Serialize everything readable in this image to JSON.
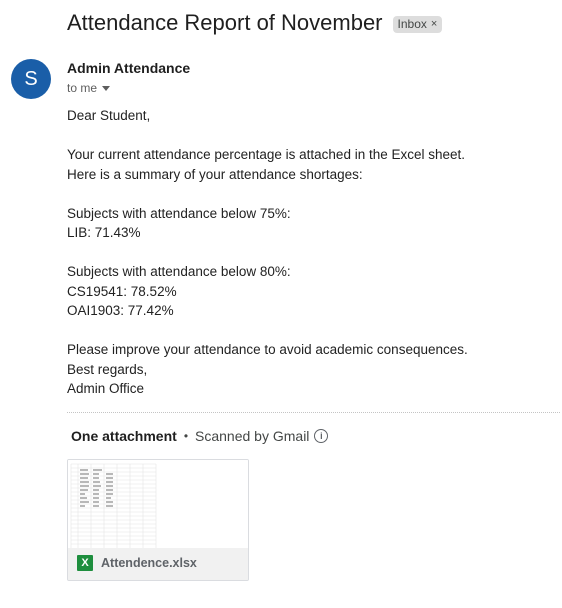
{
  "email": {
    "subject": "Attendance Report of November",
    "label": "Inbox",
    "label_close": "×",
    "avatar_letter": "S",
    "sender": "Admin Attendance",
    "recipient": "to me"
  },
  "body": {
    "lines": [
      "Dear Student,",
      "",
      "Your current attendance percentage is attached in the Excel sheet.",
      "Here is a summary of your attendance shortages:",
      "",
      "Subjects with attendance below 75%:",
      "LIB: 71.43%",
      "",
      "Subjects with attendance below 80%:",
      "CS19541: 78.52%",
      "OAI1903: 77.42%",
      "",
      "Please improve your attendance to avoid academic consequences.",
      "Best regards,",
      "Admin Office"
    ]
  },
  "attachments": {
    "count_label": "One attachment",
    "separator": "•",
    "scan_label": "Scanned by Gmail",
    "info_glyph": "i",
    "file": {
      "name": "Attendence.xlsx",
      "icon": "excel-icon",
      "icon_glyph": "X",
      "icon_color": "#1e8e3e"
    }
  },
  "colors": {
    "avatar": "#1a5ea8",
    "chip": "#dddddd",
    "excel_green": "#1e8e3e"
  }
}
